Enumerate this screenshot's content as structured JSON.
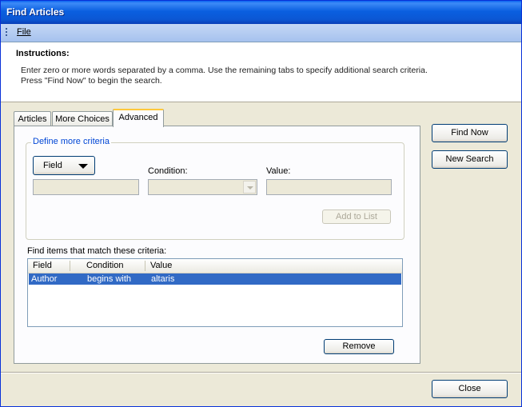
{
  "window": {
    "title": "Find Articles"
  },
  "menu": {
    "file": "File"
  },
  "instructions": {
    "heading": "Instructions:",
    "line1": "Enter zero or more words separated by a comma. Use the remaining tabs to specify additional search criteria.",
    "line2": "Press \"Find Now\" to begin the search."
  },
  "tabs": [
    {
      "label": "Articles",
      "active": false
    },
    {
      "label": "More Choices",
      "active": false
    },
    {
      "label": "Advanced",
      "active": true
    }
  ],
  "criteria": {
    "group_title": "Define more criteria",
    "field_button": "Field",
    "condition_label": "Condition:",
    "value_label": "Value:",
    "field_value": "",
    "condition_value": "",
    "value_value": "",
    "add_button": "Add to List"
  },
  "match_list": {
    "label": "Find items that match these criteria:",
    "columns": [
      "Field",
      "Condition",
      "Value"
    ],
    "rows": [
      {
        "field": "Author",
        "condition": "begins with",
        "value": "altaris",
        "selected": true
      }
    ]
  },
  "buttons": {
    "find_now": "Find Now",
    "new_search": "New Search",
    "remove": "Remove",
    "close": "Close"
  },
  "colors": {
    "title_bar": "#0a5fe0",
    "selection": "#316ac5",
    "group_title": "#0046d5"
  }
}
